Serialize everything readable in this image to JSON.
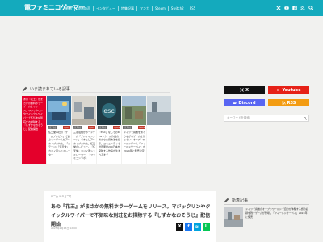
{
  "header": {
    "logo_text": "電ファミニコゲーマー",
    "nav": [
      "新着",
      "読者の声",
      "インタビュー",
      "特集記事",
      "マンガ",
      "Steam",
      "Switch2",
      "PS5"
    ],
    "icons": [
      "x-icon",
      "youtube-icon",
      "facebook-icon",
      "rss-icon",
      "search-icon"
    ],
    "bar_color": "#14aabd"
  },
  "popular": {
    "section_title": "いま読まれている記事",
    "cards": [
      {
        "category": "",
        "date": "",
        "title": "あの『花王』がまさかの無料ホラーゲームをリリース。マジックリンやクイックルワイパーで不気味な別荘をお掃除する『しずかなおそうじ』配信開始",
        "featured": true
      },
      {
        "category": "ガチ付",
        "date": "2/24",
        "title": "任天堂本社の「ゲームプレゼン」で遊ぶミニゲームがアーカイブされた。「ステージ」「任天堂」カジノ風シュミレーター",
        "featured": false
      },
      {
        "category": "ガチ付",
        "date": "2/24",
        "title": "三菱電機がボードゲーム「プレイインターン」ですこしアーカイブされた。任天堂のレビュー。「任天堂」カジノ風シュミレーター。「ファミコンラボ」",
        "featured": false
      },
      {
        "category": "ガチ付",
        "date": "2/24",
        "title": "「ESC」なしでのRPGツクール作品の新たな公開方法を提示。コミュニティで世界累計200万本を突破する作品が生まれるまで",
        "featured": false
      },
      {
        "category": "ガチ付",
        "date": "2/24",
        "title": "ドイツで廃墟をめぐりながらゲームを作っていくオープンワールドゲーム「フィールドサーベイ」が2024年に発売決定",
        "featured": false
      },
      {
        "category": "",
        "date": "",
        "title": "",
        "featured": false
      }
    ]
  },
  "social": {
    "x_label": "X",
    "youtube_label": "Youtube",
    "discord_label": "Discord",
    "rss_label": "RSS",
    "search_placeholder": "キーワードを検索"
  },
  "article": {
    "category": "ホーム > ニュース",
    "title": "あの『花王』がまさかの無料ホラーゲームをリリース。マジックリンやクイックルワイパーで不気味な別荘をお掃除する『しずかなおそうじ』配信開始",
    "date": "2025年2月25日 12:00",
    "share": [
      "X",
      "f",
      "B!",
      "L"
    ]
  },
  "new_articles": {
    "title": "新着記事",
    "item_text": "ドイツで廃墟のオープンワールドで自分が体験する旅の記録を残すゲームが登場。「フィールドサーベイ」2024年に発売"
  }
}
